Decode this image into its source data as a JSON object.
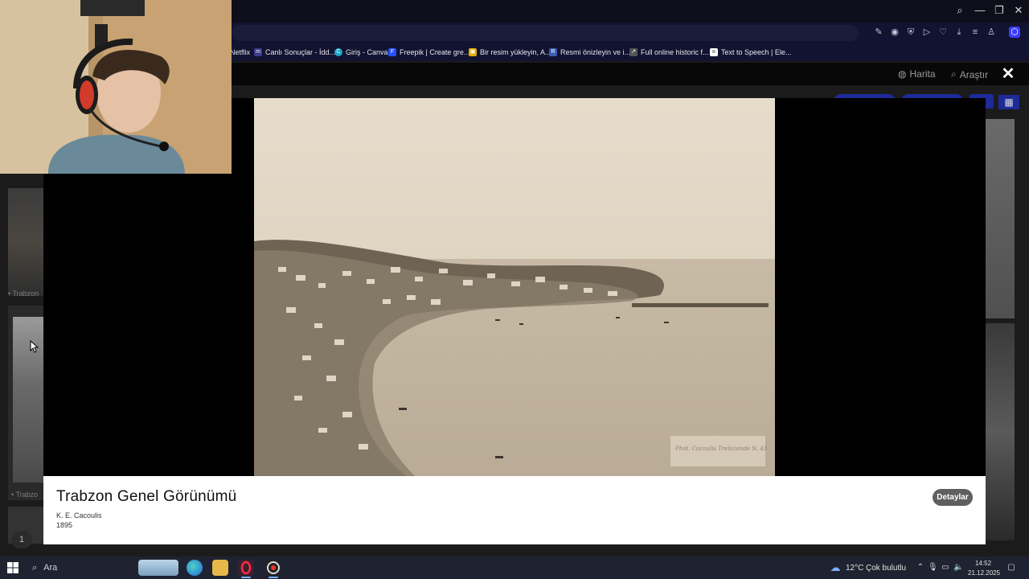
{
  "browser": {
    "window_controls": {
      "search": "⌕",
      "minimize": "—",
      "restore": "❐",
      "close": "✕"
    },
    "bookmarks": [
      {
        "label": "Netflix",
        "icon": "netflix-icon",
        "color": "#121330"
      },
      {
        "label": "Canlı Sonuçlar - İdd...",
        "icon": "m-icon",
        "color": "#3a3a8a"
      },
      {
        "label": "Giriş - Canva",
        "icon": "canva-icon",
        "color": "#1ea6c8"
      },
      {
        "label": "Freepik | Create gre...",
        "icon": "freepik-icon",
        "color": "#2550ff"
      },
      {
        "label": "Bir resim yükleyin, A...",
        "icon": "image-upload-icon",
        "color": "#e0b000"
      },
      {
        "label": "Resmi önizleyin ve i...",
        "icon": "rp-icon",
        "color": "#3c5fb0"
      },
      {
        "label": "Full online historic f...",
        "icon": "historic-icon",
        "color": "#555555"
      },
      {
        "label": "Text to Speech | Ele...",
        "icon": "elevenlabs-icon",
        "color": "#ffffff"
      }
    ]
  },
  "site_nav": {
    "map_label": "Harita",
    "search_label": "Araştır",
    "close_symbol": "✕"
  },
  "background": {
    "thumb_label_1": "• Trabzon",
    "thumb_label_2": "• Trabzo",
    "page_number": "1"
  },
  "modal": {
    "title": "Trabzon Genel Görünümü",
    "author": "K. E. Cacoulis",
    "year": "1895",
    "details_label": "Detaylar",
    "photo_inscription": "Phot. Cacoulis Trebizonde  N. 43"
  },
  "taskbar": {
    "search_placeholder": "Ara",
    "weather_temp": "12°C",
    "weather_desc": "Çok bulutlu",
    "time": "14:52",
    "date": "21.12.2025"
  },
  "colors": {
    "accent": "#1d2a9a",
    "browser_bg": "#121330",
    "caption_bg": "#ffffff",
    "details_btn": "#5f5f5f"
  }
}
